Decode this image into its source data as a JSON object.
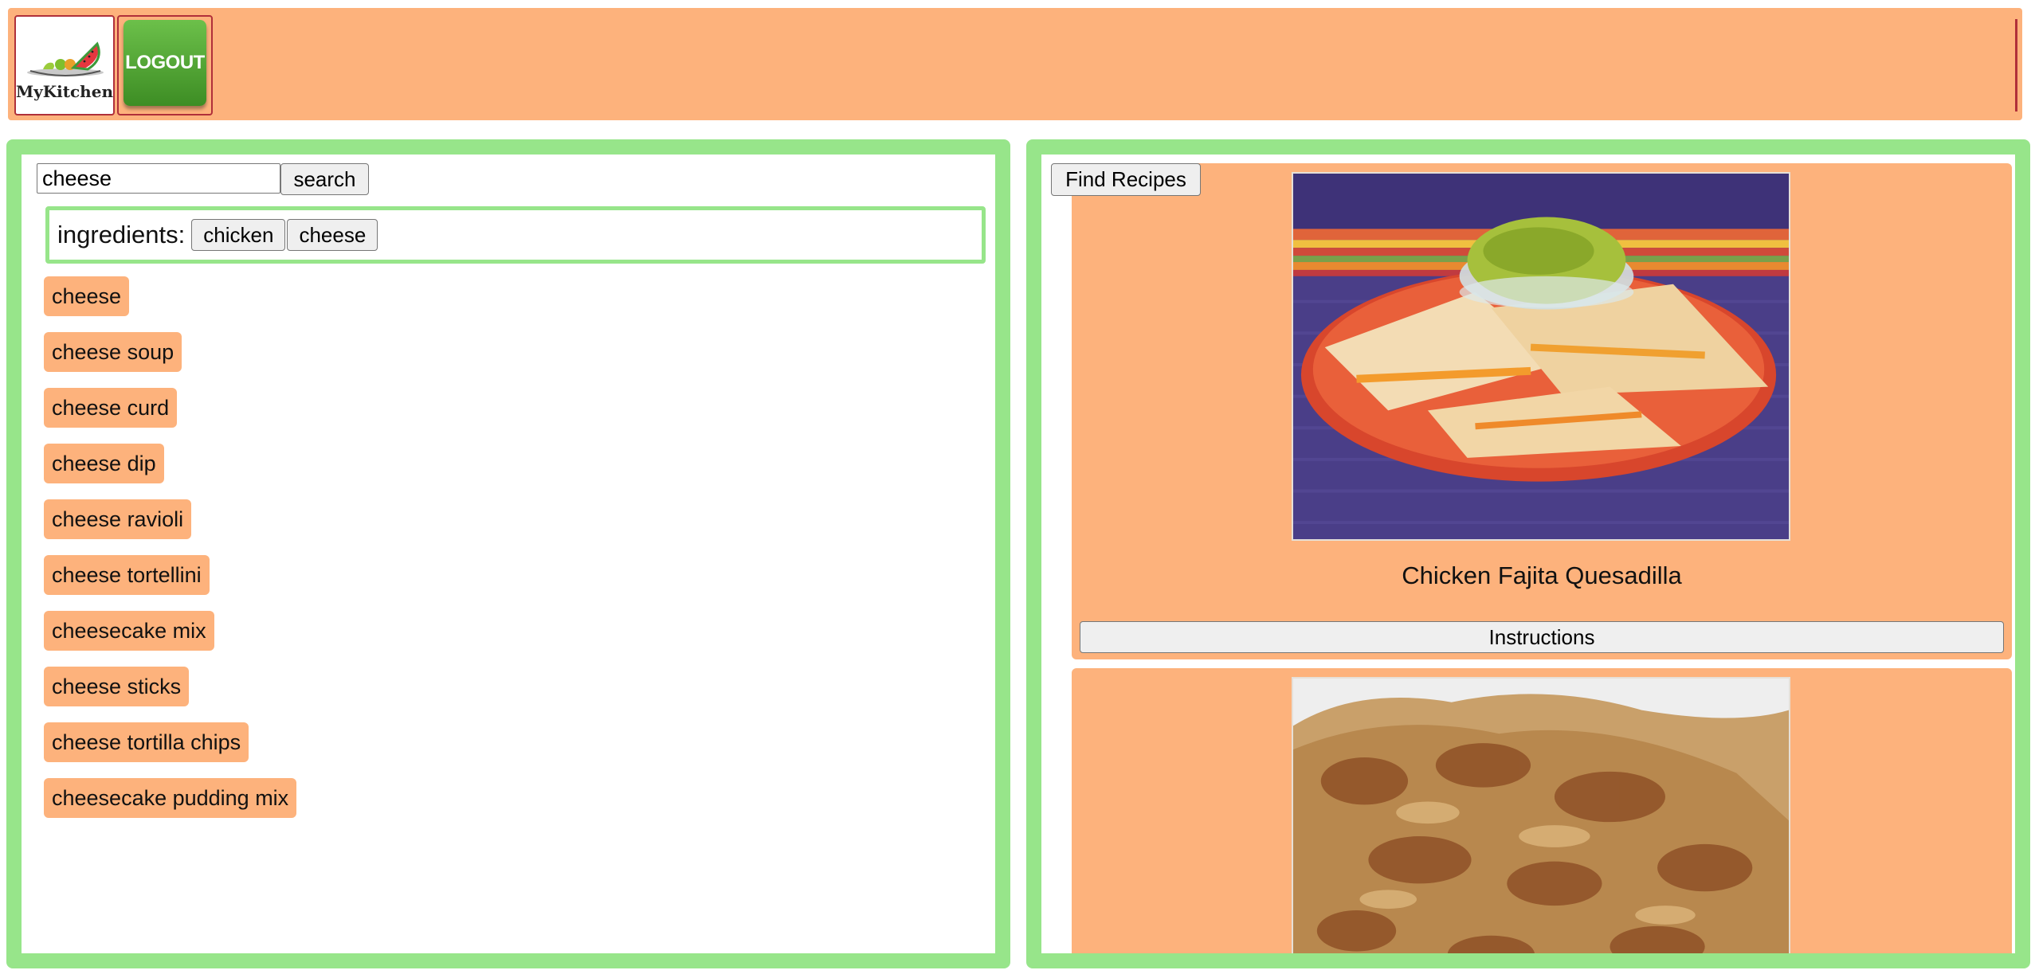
{
  "header": {
    "logo_text": "MyKitchen",
    "logout_label": "LOGOUT"
  },
  "search": {
    "value": "cheese",
    "button_label": "search"
  },
  "ingredients": {
    "label": "ingredients:",
    "chips": [
      "chicken",
      "cheese"
    ]
  },
  "suggestions": [
    "cheese",
    "cheese soup",
    "cheese curd",
    "cheese dip",
    "cheese ravioli",
    "cheese tortellini",
    "cheesecake mix",
    "cheese sticks",
    "cheese tortilla chips",
    "cheesecake pudding mix"
  ],
  "recipes_panel": {
    "find_button_label": "Find Recipes",
    "recipes": [
      {
        "title": "Chicken Fajita Quesadilla",
        "instructions_label": "Instructions",
        "photo": "quesadilla-photo"
      },
      {
        "title": "",
        "instructions_label": "",
        "photo": "breaded-cutlet-photo"
      }
    ]
  },
  "colors": {
    "header_bg": "#fdb27c",
    "panel_border": "#97e58a",
    "chip_bg": "#fdb27c",
    "logout_green": "#4da22e",
    "accent_red": "#b0303a"
  }
}
